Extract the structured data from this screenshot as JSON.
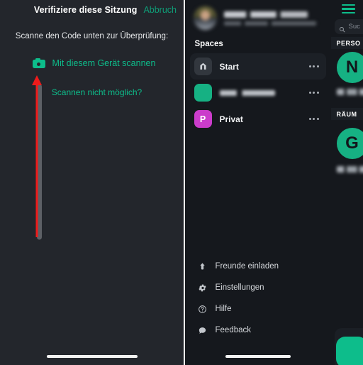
{
  "verification": {
    "title": "Verifiziere diese Sitzung",
    "cancel_label": "Abbruch",
    "instruction": "Scanne den Code unten zur Überprüfung:",
    "scan_with_device_label": "Mit diesem Gerät scannen",
    "cannot_scan_label": "Scannen nicht möglich?",
    "camera_icon": "camera-icon",
    "accent_color": "#0dbd8b",
    "annotation_arrow_color": "#ee1b1b",
    "background_color": "#23262c"
  },
  "spaces_drawer": {
    "background_color": "#15181d",
    "profile": {
      "avatar": "user-avatar-photo",
      "display_name": "",
      "user_id": ""
    },
    "section_label": "Spaces",
    "items": [
      {
        "label": "Start",
        "avatar_letter": "",
        "avatar_type": "home-icon",
        "avatar_color": "#32373e",
        "selected": true,
        "overflow": "more-options-icon"
      },
      {
        "label": "",
        "avatar_letter": "",
        "avatar_type": "image",
        "avatar_color": "#16b183",
        "selected": false,
        "overflow": "more-options-icon"
      },
      {
        "label": "Privat",
        "avatar_letter": "P",
        "avatar_type": "letter",
        "avatar_color": "#cb3ccb",
        "selected": false,
        "overflow": "more-options-icon"
      }
    ],
    "menu": [
      {
        "label": "Freunde einladen",
        "icon": "share-icon"
      },
      {
        "label": "Einstellungen",
        "icon": "gear-icon"
      },
      {
        "label": "Hilfe",
        "icon": "question-circle-icon"
      },
      {
        "label": "Feedback",
        "icon": "speech-bubble-icon"
      }
    ]
  },
  "room_list": {
    "background_color": "#15181d",
    "menu_icon": "hamburger-menu-icon",
    "menu_icon_color": "#0dbd8b",
    "search": {
      "icon": "search-icon",
      "placeholder": "Suchen",
      "visible_text": "Suc"
    },
    "sections": [
      {
        "header": "PERSONEN",
        "visible_header": "PERSO",
        "entries": [
          {
            "avatar_letter": "N",
            "avatar_color": "#16b183",
            "name": ""
          }
        ]
      },
      {
        "header": "RÄUME",
        "visible_header": "RÄUM",
        "entries": [
          {
            "avatar_letter": "G",
            "avatar_color": "#16b183",
            "name": ""
          }
        ]
      }
    ],
    "fab": {
      "icon": "compose-icon",
      "color": "#0dbd8b"
    }
  },
  "system": {
    "home_indicator": "home-indicator"
  }
}
